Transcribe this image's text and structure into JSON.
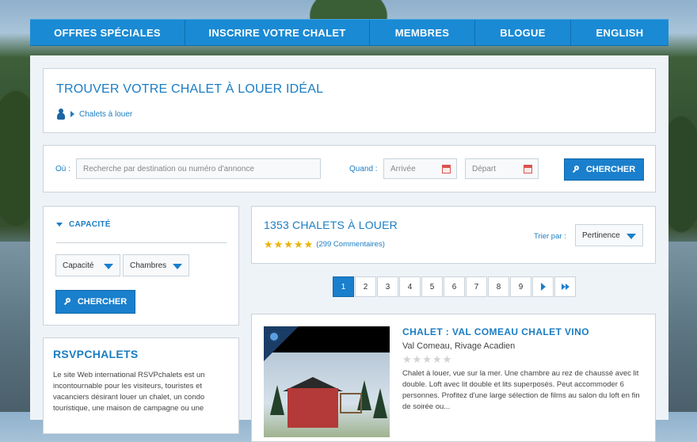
{
  "nav": {
    "items": [
      "OFFRES SPÉCIALES",
      "INSCRIRE VOTRE CHALET",
      "MEMBRES",
      "BLOGUE",
      "ENGLISH"
    ]
  },
  "header": {
    "title": "TROUVER VOTRE CHALET À LOUER IDÉAL",
    "breadcrumb": "Chalets à louer"
  },
  "search": {
    "where_label": "Où :",
    "where_placeholder": "Recherche par destination ou numéro d'annonce",
    "when_label": "Quand :",
    "arrival_placeholder": "Arrivée",
    "departure_placeholder": "Départ",
    "button_label": "CHERCHER"
  },
  "filters": {
    "heading": "CAPACITÉ",
    "capacity_select": "Capacité",
    "rooms_select": "Chambres",
    "button_label": "CHERCHER"
  },
  "about": {
    "title": "RSVPCHALETS",
    "text": "Le site Web international RSVPchalets est un incontournable pour les visiteurs, touristes et vacanciers désirant louer un chalet, un condo touristique, une maison de campagne ou une"
  },
  "results": {
    "title": "1353 CHALETS À LOUER",
    "rating": 5,
    "reviews": "(299 Commentaires)",
    "sort_label": "Trier par :",
    "sort_value": "Pertinence"
  },
  "pagination": {
    "pages": [
      "1",
      "2",
      "3",
      "4",
      "5",
      "6",
      "7",
      "8",
      "9"
    ],
    "current": "1"
  },
  "listing": {
    "title": "CHALET : VAL COMEAU CHALET VINO",
    "location": "Val Comeau, Rivage Acadien",
    "rating": 0,
    "description": "Chalet à louer, vue sur la mer. Une chambre au rez de chaussé avec lit double. Loft avec lit double et lits superposés. Peut accommoder 6 personnes. Profitez d'une large sélection de films au salon du loft en fin de soirée ou..."
  },
  "colors": {
    "brand_blue": "#1a8ad4",
    "link_blue": "#1b7dc3",
    "star_gold": "#e9b308"
  }
}
